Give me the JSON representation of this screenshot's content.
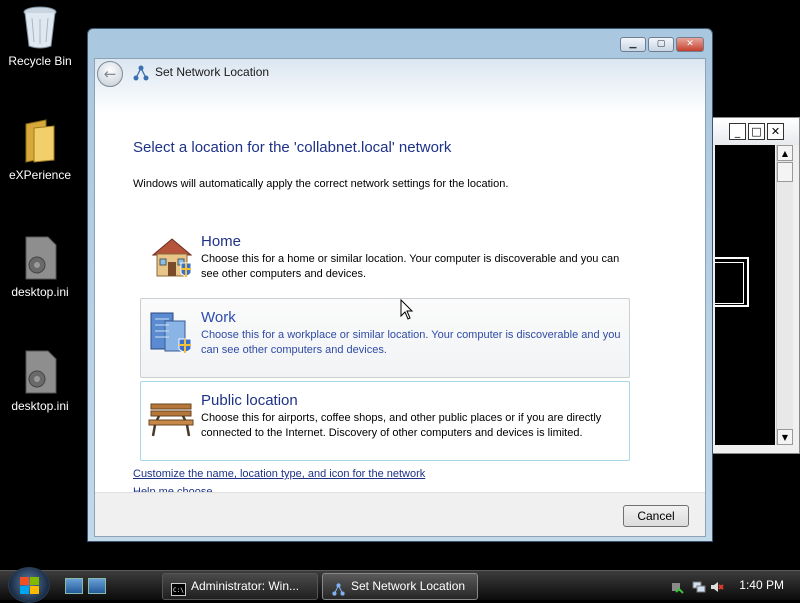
{
  "desktop": {
    "icons": [
      {
        "label": "Recycle Bin",
        "icon": "recycle-bin-icon"
      },
      {
        "label": "eXPerience",
        "icon": "folder-icon"
      },
      {
        "label": "desktop.ini",
        "icon": "settings-file-icon"
      },
      {
        "label": "desktop.ini",
        "icon": "settings-file-icon"
      }
    ]
  },
  "dialog": {
    "title": "Set Network Location",
    "heading": "Select a location for the 'collabnet.local' network",
    "subtext": "Windows will automatically apply the correct network settings for the location.",
    "options": [
      {
        "title": "Home",
        "description": "Choose this for a home or similar location. Your computer is discoverable and you can see other computers and devices.",
        "icon": "home-icon"
      },
      {
        "title": "Work",
        "description": "Choose this for a workplace or similar location. Your computer is discoverable and you can see other computers and devices.",
        "icon": "office-building-icon"
      },
      {
        "title": "Public location",
        "description": "Choose this for airports, coffee shops, and other public places or if you are directly connected to the Internet. Discovery of other computers and devices is limited.",
        "icon": "park-bench-icon"
      }
    ],
    "links": {
      "customize": "Customize the name, location type, and icon for the network",
      "help": "Help me choose"
    },
    "cancel_label": "Cancel"
  },
  "taskbar": {
    "tasks": [
      {
        "label": "Administrator:  Win...",
        "icon": "command-prompt-icon"
      },
      {
        "label": "Set Network Location",
        "icon": "network-icon"
      }
    ],
    "clock": "1:40 PM"
  },
  "colors": {
    "accent": "#1e3287",
    "link": "#1e3287",
    "selection_border": "#a7d6e6"
  }
}
